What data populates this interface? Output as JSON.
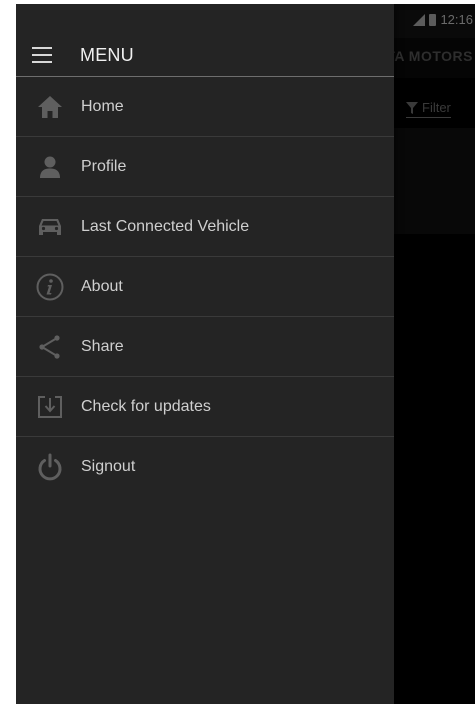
{
  "status_bar": {
    "time": "12:16"
  },
  "background_app": {
    "brand": "TA MOTORS",
    "filter_label": "Filter"
  },
  "drawer": {
    "title": "MENU",
    "items": [
      {
        "label": "Home",
        "icon": "home-icon"
      },
      {
        "label": "Profile",
        "icon": "profile-icon"
      },
      {
        "label": "Last Connected Vehicle",
        "icon": "car-icon"
      },
      {
        "label": "About",
        "icon": "info-icon"
      },
      {
        "label": "Share",
        "icon": "share-icon"
      },
      {
        "label": "Check for updates",
        "icon": "download-icon"
      },
      {
        "label": "Signout",
        "icon": "power-icon"
      }
    ]
  },
  "colors": {
    "drawer_bg": "#242424",
    "icon_gray": "#5f5f5f",
    "text": "#cfcfcf",
    "divider": "#3a3a3a"
  }
}
